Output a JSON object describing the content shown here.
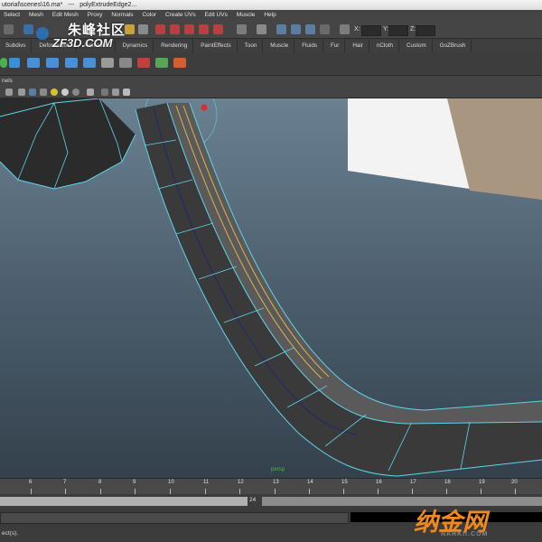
{
  "window": {
    "title_path": "utorial\\scenes\\16.ma*",
    "title_sep": "---",
    "title_node": "polyExtrudeEdge2..."
  },
  "menubar": [
    "Select",
    "Mesh",
    "Edit Mesh",
    "Proxy",
    "Normals",
    "Color",
    "Create UVs",
    "Edit UVs",
    "Muscle",
    "Help"
  ],
  "statusline": {
    "field_x_label": "X:",
    "field_y_label": "Y:",
    "field_z_label": "Z:"
  },
  "shelf_tabs": [
    "Subdivs",
    "Deformation",
    "Animation",
    "Dynamics",
    "Rendering",
    "PaintEffects",
    "Toon",
    "Muscle",
    "Fluids",
    "Fur",
    "Hair",
    "nCloth",
    "Custom",
    "GoZBrush"
  ],
  "panel_menu": "nels",
  "viewport": {
    "axis_label": "persp"
  },
  "timeline": {
    "ticks": [
      "6",
      "7",
      "8",
      "9",
      "10",
      "11",
      "12",
      "13",
      "14",
      "15",
      "16",
      "17",
      "18",
      "19",
      "20"
    ],
    "current_frame": "24"
  },
  "helpline": {
    "text": "ect(s)."
  },
  "watermarks": {
    "top_cn": "朱峰社区",
    "top_en": "ZF3D.COM",
    "bottom_cn": "纳金网",
    "bottom_en": "NARKII.COM"
  },
  "colors": {
    "wire_highlight": "#5fd3e8",
    "selected_edge": "#e0b24a",
    "viewport_top": "#6a8192",
    "viewport_bottom": "#34414c"
  }
}
